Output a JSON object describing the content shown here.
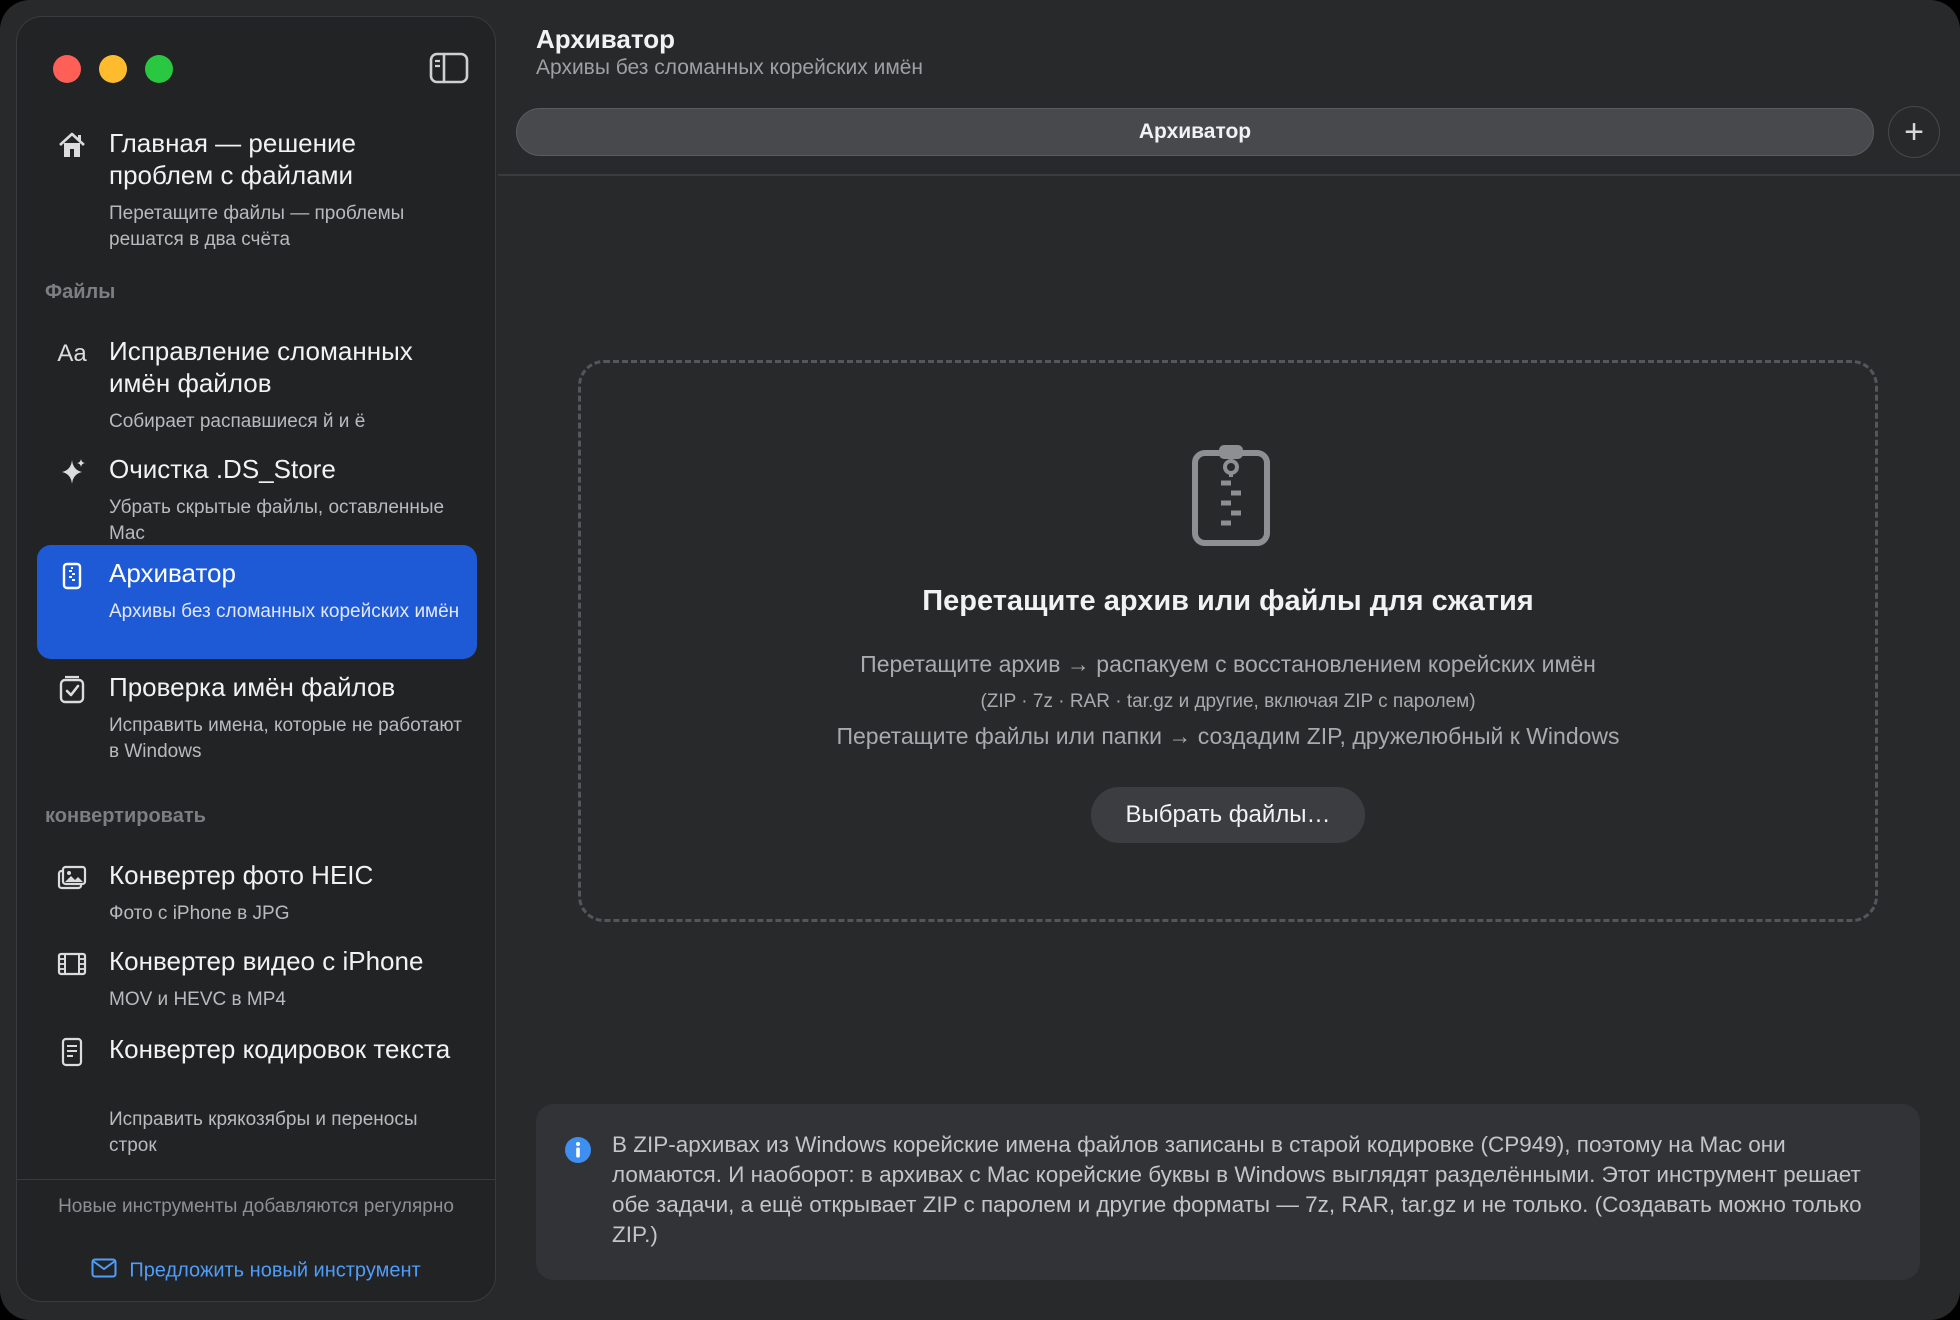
{
  "sidebar": {
    "home": {
      "title": "Главная — решение проблем с файлами",
      "subtitle": "Перетащите файлы — проблемы решатся в два счёта",
      "icon": "house-icon"
    },
    "section_files": "Файлы",
    "section_convert": "конвертировать",
    "items": [
      {
        "title": "Исправление сломанных имён файлов",
        "subtitle": "Собирает распавшиеся й и ё",
        "icon": "text-aa-icon"
      },
      {
        "title": "Очистка .DS_Store",
        "subtitle": "Убрать скрытые файлы, оставленные Mac",
        "icon": "sparkles-icon"
      },
      {
        "title": "Архиватор",
        "subtitle": "Архивы без сломанных корейских имён",
        "icon": "archive-zipper-icon"
      },
      {
        "title": "Проверка имён файлов",
        "subtitle": "Исправить имена, которые не работают в Windows",
        "icon": "checklist-icon"
      }
    ],
    "convert_items": [
      {
        "title": "Конвертер фото HEIC",
        "subtitle": "Фото с iPhone в JPG",
        "icon": "photos-icon"
      },
      {
        "title": "Конвертер видео с iPhone",
        "subtitle": "MOV и HEVC в MP4",
        "icon": "film-icon"
      },
      {
        "title": "Конвертер кодировок текста",
        "subtitle": "Исправить крякозябры и переносы строк",
        "icon": "document-text-icon"
      }
    ],
    "footer_note": "Новые инструменты добавляются регулярно",
    "footer_link": "Предложить новый инструмент"
  },
  "header": {
    "title": "Архиватор",
    "subtitle": "Архивы без сломанных корейских имён"
  },
  "tab": {
    "label": "Архиватор"
  },
  "dropzone": {
    "title": "Перетащите архив или файлы для сжатия",
    "line1": "Перетащите архив → распакуем с восстановлением корейских имён",
    "line2": "(ZIP · 7z · RAR · tar.gz и другие, включая ZIP с паролем)",
    "line3": "Перетащите файлы или папки → создадим ZIP, дружелюбный к Windows",
    "button": "Выбрать файлы…"
  },
  "info": {
    "text": "В ZIP-архивах из Windows корейские имена файлов записаны в старой кодировке (CP949), поэтому на Mac они ломаются. И наоборот: в архивах с Mac корейские буквы в Windows выглядят разделёнными. Этот инструмент решает обе задачи, а ещё открывает ZIP с паролем и другие форматы — 7z, RAR, tar.gz и не только. (Создавать можно только ZIP.)"
  },
  "colors": {
    "accent": "#1f5ad6",
    "link": "#4f9dfb",
    "info_icon": "#3e8ff0"
  }
}
